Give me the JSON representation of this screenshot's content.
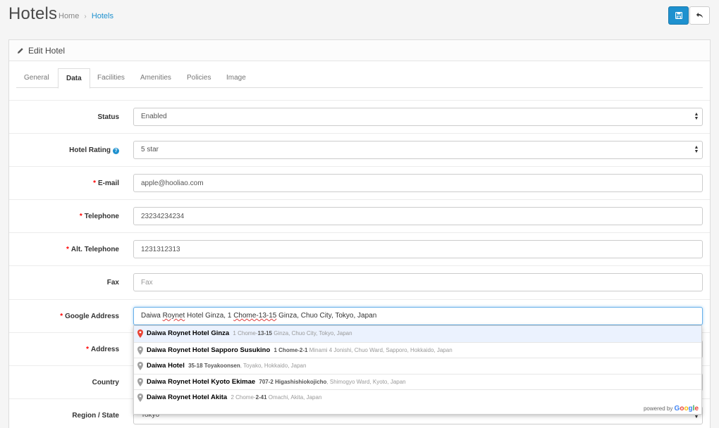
{
  "header": {
    "title": "Hotels",
    "breadcrumb": {
      "home": "Home",
      "current": "Hotels"
    },
    "save_icon": "save-icon",
    "back_icon": "reply-icon"
  },
  "panel": {
    "title": "Edit Hotel",
    "icon": "pencil-icon"
  },
  "tabs": [
    {
      "label": "General",
      "active": false
    },
    {
      "label": "Data",
      "active": true
    },
    {
      "label": "Facilities",
      "active": false
    },
    {
      "label": "Amenities",
      "active": false
    },
    {
      "label": "Policies",
      "active": false
    },
    {
      "label": "Image",
      "active": false
    }
  ],
  "form": {
    "status": {
      "label": "Status",
      "value": "Enabled"
    },
    "hotel_rating": {
      "label": "Hotel Rating",
      "value": "5 star"
    },
    "email": {
      "label": "E-mail",
      "value": "apple@hooliao.com"
    },
    "telephone": {
      "label": "Telephone",
      "value": "23234234234"
    },
    "alt_telephone": {
      "label": "Alt. Telephone",
      "value": "1231312313"
    },
    "fax": {
      "label": "Fax",
      "placeholder": "Fax"
    },
    "google_address": {
      "label": "Google Address",
      "value": "Daiwa Roynet Hotel Ginza, 1 Chome-13-15 Ginza, Chuo City, Tokyo, Japan",
      "parts": [
        "Daiwa ",
        "Roynet",
        " Hotel Ginza, 1 ",
        "Chome-13-15",
        " Ginza, Chuo City, Tokyo, Japan"
      ]
    },
    "address": {
      "label": "Address"
    },
    "country": {
      "label": "Country"
    },
    "region": {
      "label": "Region / State",
      "value": "Tokyo"
    }
  },
  "autocomplete": {
    "items": [
      {
        "main": "Daiwa Roynet Hotel Ginza",
        "sub_bold": "",
        "sub_pre": "1 Chome-",
        "sub_match": "13-15",
        "sub_rest": " Ginza, Chuo City, Tokyo, Japan"
      },
      {
        "main": "Daiwa Roynet Hotel Sapporo Susukino",
        "sub_bold": "1 Chome-2-1",
        "sub_pre": "",
        "sub_match": "",
        "sub_rest": " Minami 4 Jonishi, Chuo Ward, Sapporo, Hokkaido, Japan"
      },
      {
        "main": "Daiwa Hotel",
        "sub_bold": "35-18 Toyakoonsen",
        "sub_pre": "",
        "sub_match": "",
        "sub_rest": ", Toyako, Hokkaido, Japan"
      },
      {
        "main": "Daiwa Roynet Hotel Kyoto Ekimae",
        "sub_bold": "707-2 Higashishiokojicho",
        "sub_pre": "",
        "sub_match": "",
        "sub_rest": ", Shimogyo Ward, Kyoto, Japan"
      },
      {
        "main": "Daiwa Roynet Hotel Akita",
        "sub_bold": "",
        "sub_pre": "2 Chome-",
        "sub_match": "2-41",
        "sub_rest": " Omachi, Akita, Japan"
      }
    ],
    "footer_prefix": "powered by",
    "footer_brand": [
      "G",
      "o",
      "o",
      "g",
      "l",
      "e"
    ]
  },
  "colors": {
    "primary": "#1e91cf",
    "required": "#ff0000",
    "highlight_row": "#ebf2fe",
    "pin_active": "#e84335",
    "pin_inactive": "#a0a0a0"
  }
}
